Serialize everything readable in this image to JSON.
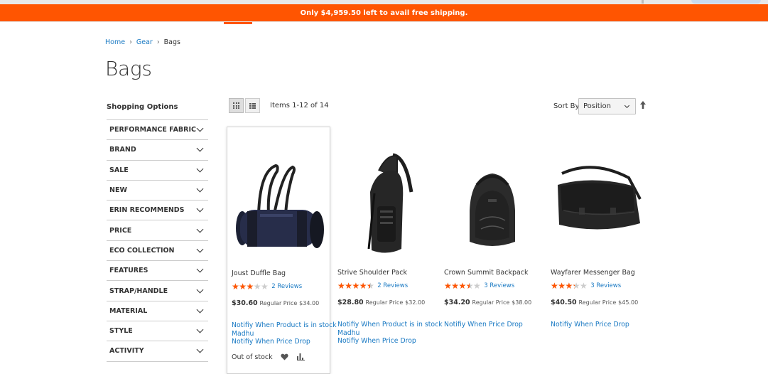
{
  "banner": {
    "text": "Only $4,959.50 left to avail free shipping."
  },
  "breadcrumb": {
    "home": "Home",
    "sep1": "›",
    "gear": "Gear",
    "sep2": "›",
    "current": "Bags"
  },
  "page": {
    "title": "Bags"
  },
  "sidebar": {
    "heading": "Shopping Options",
    "filters": [
      "PERFORMANCE FABRIC",
      "BRAND",
      "SALE",
      "NEW",
      "ERIN RECOMMENDS",
      "PRICE",
      "ECO COLLECTION",
      "FEATURES",
      "STRAP/HANDLE",
      "MATERIAL",
      "STYLE",
      "ACTIVITY"
    ]
  },
  "toolbar": {
    "items_count": "Items 1-12 of 14",
    "sort_label": "Sort By",
    "sort_value": "Position"
  },
  "products": [
    {
      "name": "Joust Duffle Bag",
      "rating_percent": 60,
      "reviews": "2  Reviews",
      "price": "$30.60",
      "regular_label": "Regular Price",
      "regular_price": "$34.00",
      "links": [
        "Notifiy When Product is in stock",
        "Madhu",
        "Notifiy When Price Drop"
      ],
      "stock": "Out of stock"
    },
    {
      "name": "Strive Shoulder Pack",
      "rating_percent": 90,
      "reviews": "2  Reviews",
      "price": "$28.80",
      "regular_label": "Regular Price",
      "regular_price": "$32.00",
      "links": [
        "Notifiy When Product is in stock",
        "Madhu",
        "Notifiy When Price Drop"
      ]
    },
    {
      "name": "Crown Summit Backpack",
      "rating_percent": 70,
      "reviews": "3  Reviews",
      "price": "$34.20",
      "regular_label": "Regular Price",
      "regular_price": "$38.00",
      "links": [
        "Notifiy When Price Drop"
      ]
    },
    {
      "name": "Wayfarer Messenger Bag",
      "rating_percent": 67,
      "reviews": "3  Reviews",
      "price": "$40.50",
      "regular_label": "Regular Price",
      "regular_price": "$45.00",
      "links": [
        "Notifiy When Price Drop"
      ]
    }
  ],
  "colors": {
    "accent": "#ff5501",
    "link": "#1979c3"
  }
}
